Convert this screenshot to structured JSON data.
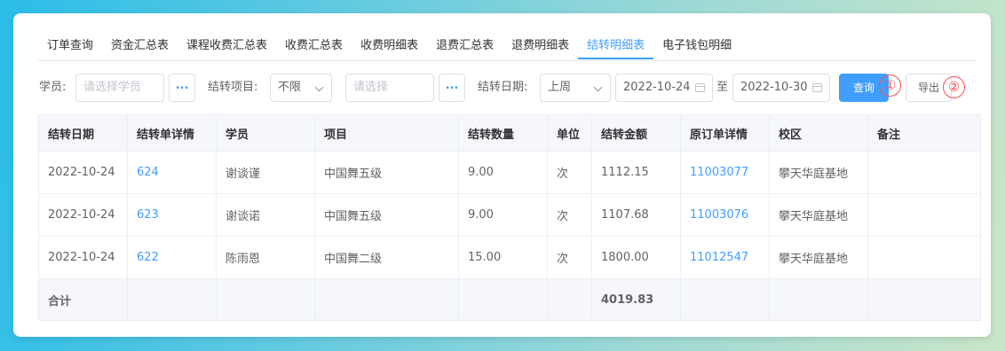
{
  "tabs": [
    {
      "label": "订单查询"
    },
    {
      "label": "资金汇总表"
    },
    {
      "label": "课程收费汇总表"
    },
    {
      "label": "收费汇总表"
    },
    {
      "label": "收费明细表"
    },
    {
      "label": "退费汇总表"
    },
    {
      "label": "退费明细表"
    },
    {
      "label": "结转明细表",
      "active": true
    },
    {
      "label": "电子钱包明细"
    }
  ],
  "filters": {
    "student_label": "学员:",
    "student_placeholder": "请选择学员",
    "project_label": "结转项目:",
    "project_value": "不限",
    "project_detail_placeholder": "请选择",
    "date_label": "结转日期:",
    "date_range_value": "上周",
    "date_start": "2022-10-24",
    "date_to": "至",
    "date_end": "2022-10-30",
    "dots": "...",
    "query_button": "查询",
    "export_button": "导出",
    "marker_1": "①",
    "marker_2": "②"
  },
  "table": {
    "headers": [
      "结转日期",
      "结转单详情",
      "学员",
      "项目",
      "结转数量",
      "单位",
      "结转金额",
      "原订单详情",
      "校区",
      "备注"
    ],
    "rows": [
      [
        "2022-10-24",
        "624",
        "谢谈谨",
        "中国舞五级",
        "9.00",
        "次",
        "1112.15",
        "11003077",
        "攀天华庭基地",
        ""
      ],
      [
        "2022-10-24",
        "623",
        "谢谈诺",
        "中国舞五级",
        "9.00",
        "次",
        "1107.68",
        "11003076",
        "攀天华庭基地",
        ""
      ],
      [
        "2022-10-24",
        "622",
        "陈雨恩",
        "中国舞二级",
        "15.00",
        "次",
        "1800.00",
        "11012547",
        "攀天华庭基地",
        ""
      ]
    ],
    "total_label": "合计",
    "total_amount": "4019.83"
  },
  "colors": {
    "accent": "#409eff",
    "marker": "#ff4d4f"
  }
}
